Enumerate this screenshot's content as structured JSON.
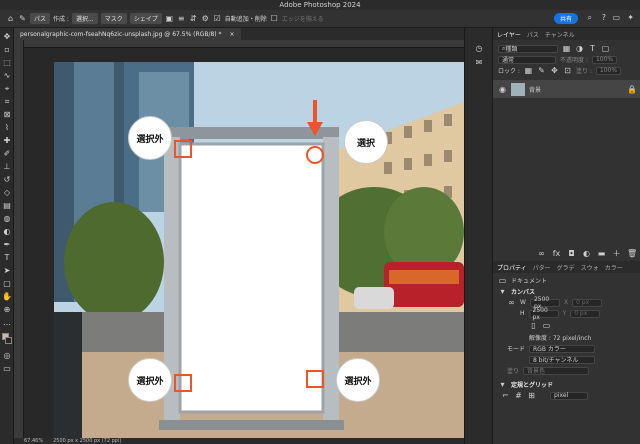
{
  "window": {
    "title": "Adobe Photoshop 2024"
  },
  "options_bar": {
    "mode": "パス",
    "create_label": "作成 :",
    "select": "選択...",
    "mask": "マスク",
    "shape": "シェイプ",
    "auto_add": "自動追加・削除",
    "align_edges": "エッジを揃える",
    "share": "共有"
  },
  "document": {
    "tab_title": "personalgraphic-com-fseahNq6zic-unsplash.jpg @ 67.5% (RGB/8) *",
    "zoom": "67.46%",
    "dimensions": "2500 px x 2500 px (72 ppi)"
  },
  "layers_panel": {
    "tabs": [
      "レイヤー",
      "パス",
      "チャンネル"
    ],
    "search_kind": "種類",
    "blend_mode": "通常",
    "opacity_label": "不透明度 :",
    "opacity": "100%",
    "lock_label": "ロック :",
    "fill_label": "塗り :",
    "fill": "100%",
    "layer_name": "背景"
  },
  "properties_panel": {
    "tabs": [
      "プロパティ",
      "パター",
      "グラデ",
      "スウォ",
      "カラー"
    ],
    "doc_label": "ドキュメント",
    "canvas_title": "カンバス",
    "w_label": "W",
    "w": "2500 px",
    "h_label": "H",
    "h": "2500 px",
    "x_label": "X",
    "y_label": "Y",
    "x": "0 px",
    "y": "0 px",
    "resolution": "解像度 : 72 pixel/inch",
    "mode_label": "モード",
    "mode": "RGB カラー",
    "depth": "8 bit/チャンネル",
    "fill_label": "塗り",
    "fill_value": "背景色",
    "rulers_title": "定規とグリッド",
    "grid_unit": "pixel"
  },
  "annotations": {
    "top_left": "選択外",
    "top_right": "選択",
    "bottom_left": "選択外",
    "bottom_right": "選択外"
  },
  "colors": {
    "accent": "#e8562a",
    "share": "#1473e6"
  }
}
